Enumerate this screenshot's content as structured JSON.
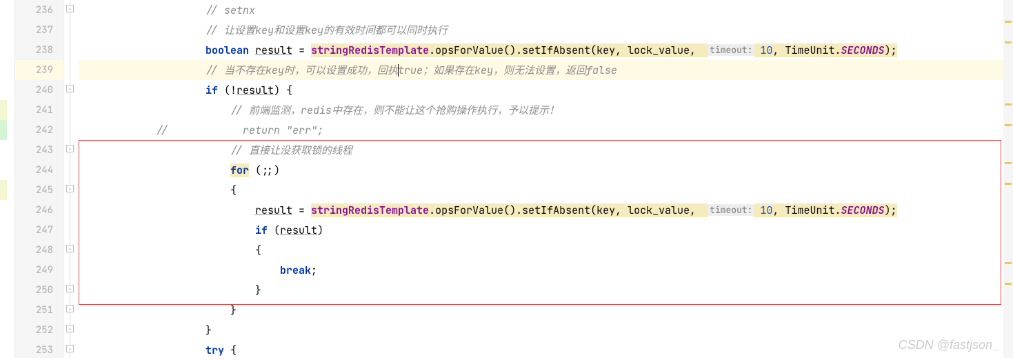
{
  "line_numbers": [
    "236",
    "237",
    "238",
    "239",
    "240",
    "241",
    "242",
    "243",
    "244",
    "245",
    "246",
    "247",
    "248",
    "249",
    "250",
    "251",
    "252",
    "253"
  ],
  "current_line_index": 3,
  "code": {
    "l236": {
      "indent": "                    ",
      "c1": "// setnx"
    },
    "l237": {
      "indent": "                    ",
      "c1": "// 让设置key和设置key的有效时间都可以同时执行"
    },
    "l238": {
      "indent": "                    ",
      "kw": "boolean",
      "sp": " ",
      "var": "result",
      "eq": " = ",
      "obj": "stringRedisTemplate",
      "m1": ".opsForValue().setIfAbsent(key, lock_value,  ",
      "hint": "timeout:",
      "num": " 10",
      "args": ", TimeUnit.",
      "sf": "SECONDS",
      "end": ");"
    },
    "l239": {
      "indent": "                    ",
      "c1": "// 当不存在key时，可以设置成功，回执",
      "c1b": "true；如果存在key，则无法设置，返回false"
    },
    "l240": {
      "indent": "                    ",
      "kw": "if",
      "rest": " (!",
      "var": "result",
      "end": ") {"
    },
    "l241": {
      "indent": "                        ",
      "c1": "// 前端监测，redis中存在，则不能让这个抢购操作执行，予以提示！"
    },
    "l242": {
      "indent": "            ",
      "cc": "//",
      "indent2": "            ",
      "ret": "return ",
      "str": "\"err\"",
      "semi": ";"
    },
    "l243": {
      "indent": "                        ",
      "c1": "// 直接让没获取锁的线程"
    },
    "l244": {
      "indent": "                        ",
      "kw": "for",
      "rest": " (;;)"
    },
    "l245": {
      "indent": "                        ",
      "br": "{"
    },
    "l246": {
      "indent": "                            ",
      "var": "result",
      "eq": " = ",
      "obj": "stringRedisTemplate",
      "m1": ".opsForValue().setIfAbsent(key, lock_value,  ",
      "hint": "timeout:",
      "num": " 10",
      "args": ", TimeUnit.",
      "sf": "SECONDS",
      "end": ");"
    },
    "l247": {
      "indent": "                            ",
      "kw": "if",
      "rest": " (",
      "var": "result",
      "end": ")"
    },
    "l248": {
      "indent": "                            ",
      "br": "{"
    },
    "l249": {
      "indent": "                                ",
      "kw": "break",
      "end": ";"
    },
    "l250": {
      "indent": "                            ",
      "br": "}"
    },
    "l251": {
      "indent": "                        ",
      "br": "}"
    },
    "l252": {
      "indent": "                    ",
      "br": "}"
    },
    "l253": {
      "indent": "                    ",
      "kw": "try",
      "rest": " {"
    }
  },
  "watermark": "CSDN @fastjson_",
  "red_box": {
    "top_line": 7,
    "bottom_line": 15
  }
}
